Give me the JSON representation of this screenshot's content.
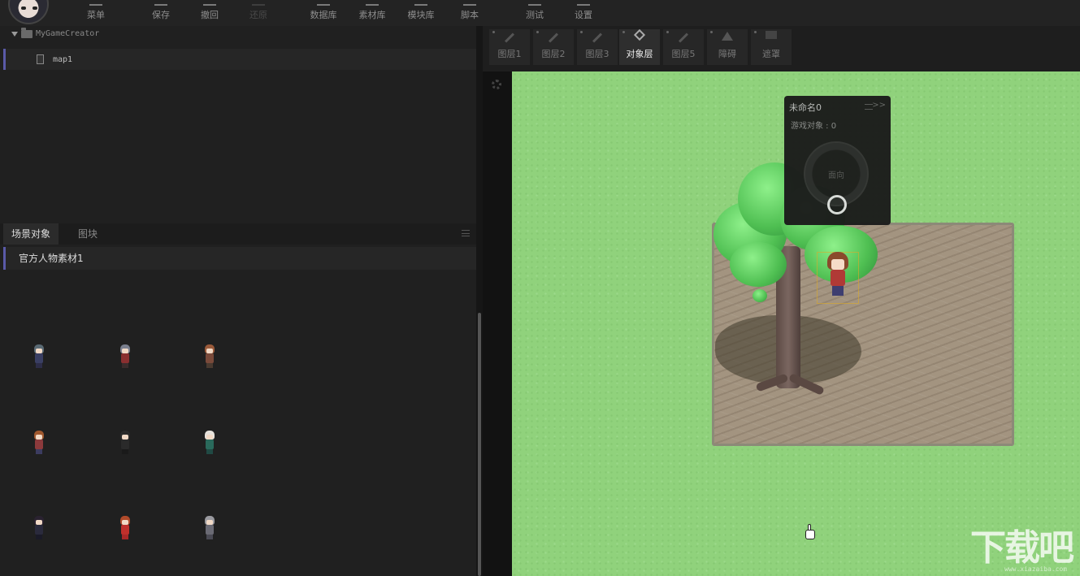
{
  "toolbar": {
    "items": [
      {
        "label": "菜单",
        "enabled": true
      },
      {
        "label": "保存",
        "enabled": true
      },
      {
        "label": "撤回",
        "enabled": true
      },
      {
        "label": "还原",
        "enabled": false
      },
      {
        "label": "数据库",
        "enabled": true
      },
      {
        "label": "素材库",
        "enabled": true
      },
      {
        "label": "模块库",
        "enabled": true
      },
      {
        "label": "脚本",
        "enabled": true
      },
      {
        "label": "测试",
        "enabled": true
      },
      {
        "label": "设置",
        "enabled": true
      }
    ]
  },
  "project_tree": {
    "root": "MyGameCreator",
    "items": [
      {
        "label": "map1",
        "selected": true
      }
    ]
  },
  "asset_panel": {
    "tabs": [
      {
        "label": "场景对象",
        "active": true
      },
      {
        "label": "图块",
        "active": false
      }
    ],
    "category": "官方人物素材1",
    "sprites": [
      {
        "name": "sprite-1",
        "hair": "#5a6a74",
        "body": "#3a3f63",
        "legs": "#2d2d48"
      },
      {
        "name": "sprite-2",
        "hair": "#7a7f8e",
        "body": "#8a2f30",
        "legs": "#3a2c2c"
      },
      {
        "name": "sprite-3",
        "hair": "#9a5a3a",
        "body": "#7a4a3a",
        "legs": "#4a3a30"
      },
      {
        "name": "sprite-4",
        "hair": "#a0582e",
        "body": "#8c3a3c",
        "legs": "#3c3c60"
      },
      {
        "name": "sprite-5",
        "hair": "#2a2a2a",
        "body": "#2a2a2a",
        "legs": "#1a1a1a"
      },
      {
        "name": "sprite-6",
        "hair": "#e6e2dc",
        "body": "#2a6a5c",
        "legs": "#204a44"
      },
      {
        "name": "sprite-7",
        "hair": "#2a2230",
        "body": "#2a2a3c",
        "legs": "#1a1a28"
      },
      {
        "name": "sprite-8",
        "hair": "#b04a2a",
        "body": "#c0302c",
        "legs": "#a82828"
      },
      {
        "name": "sprite-9",
        "hair": "#9a9aa0",
        "body": "#6a6a74",
        "legs": "#4a4a54"
      }
    ]
  },
  "layers": [
    {
      "label": "图层1",
      "icon": "pen-icon",
      "active": false
    },
    {
      "label": "图层2",
      "icon": "pen-icon",
      "active": false
    },
    {
      "label": "图层3",
      "icon": "pen-icon",
      "active": false
    },
    {
      "label": "对象层",
      "icon": "object-layer-icon",
      "active": true
    },
    {
      "label": "图层5",
      "icon": "pen-icon",
      "active": false
    },
    {
      "label": "障碍",
      "icon": "obstacle-icon",
      "active": false
    },
    {
      "label": "遮罩",
      "icon": "mask-icon",
      "active": false
    }
  ],
  "joystick_panel": {
    "title": "未命名0",
    "object_count": "游戏对象 : 0",
    "ring_label": "面向",
    "expand": ">>"
  },
  "watermark": {
    "text": "下载吧",
    "sub": "www.xiazaiba.com"
  },
  "colors": {
    "accent": "#5a5aa8",
    "grass": "#90d27c",
    "dirt": "#a39480"
  }
}
